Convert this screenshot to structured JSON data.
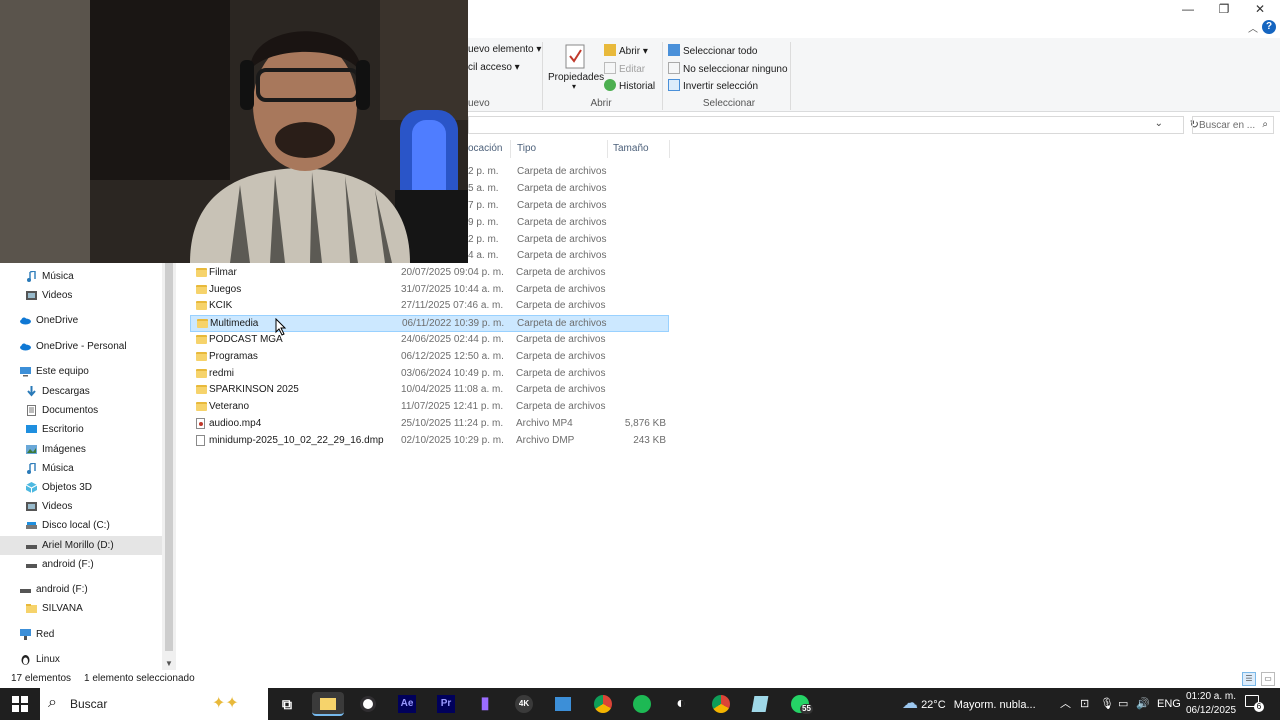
{
  "window": {
    "minimize": "—",
    "maximize": "❐",
    "close": "✕",
    "help": "?",
    "collapse": "︿"
  },
  "ribbon": {
    "new_item": "uevo elemento",
    "easy_access": "cil acceso",
    "new_group": "uevo",
    "properties": "Propiedades",
    "open": "Abrir",
    "edit": "Editar",
    "history": "Historial",
    "open_group": "Abrir",
    "select_all": "Seleccionar todo",
    "select_none": "No seleccionar ninguno",
    "invert_selection": "Invertir selección",
    "select_group": "Seleccionar"
  },
  "address": {
    "search_placeholder": "Buscar en ..."
  },
  "columns": {
    "location": "ocación",
    "type": "Tipo",
    "size": "Tamaño"
  },
  "partial_rows": [
    {
      "date": "2 p. m.",
      "type": "Carpeta de archivos"
    },
    {
      "date": "5 a. m.",
      "type": "Carpeta de archivos"
    },
    {
      "date": "7 p. m.",
      "type": "Carpeta de archivos"
    },
    {
      "date": "9 p. m.",
      "type": "Carpeta de archivos"
    },
    {
      "date": "2 p. m.",
      "type": "Carpeta de archivos"
    },
    {
      "date": "4 a. m.",
      "type": "Carpeta de archivos"
    }
  ],
  "files": [
    {
      "name": "Filmar",
      "date": "20/07/2025 09:04 p. m.",
      "type": "Carpeta de archivos",
      "size": "",
      "kind": "folder"
    },
    {
      "name": "Juegos",
      "date": "31/07/2025 10:44 a. m.",
      "type": "Carpeta de archivos",
      "size": "",
      "kind": "folder"
    },
    {
      "name": "KCIK",
      "date": "27/11/2025 07:46 a. m.",
      "type": "Carpeta de archivos",
      "size": "",
      "kind": "folder"
    },
    {
      "name": "Multimedia",
      "date": "06/11/2022 10:39 p. m.",
      "type": "Carpeta de archivos",
      "size": "",
      "kind": "folder"
    },
    {
      "name": "PODCAST MGA",
      "date": "24/06/2025 02:44 p. m.",
      "type": "Carpeta de archivos",
      "size": "",
      "kind": "folder"
    },
    {
      "name": "Programas",
      "date": "06/12/2025 12:50 a. m.",
      "type": "Carpeta de archivos",
      "size": "",
      "kind": "folder"
    },
    {
      "name": "redmi",
      "date": "03/06/2024 10:49 p. m.",
      "type": "Carpeta de archivos",
      "size": "",
      "kind": "folder"
    },
    {
      "name": "SPARKINSON 2025",
      "date": "10/04/2025 11:08 a. m.",
      "type": "Carpeta de archivos",
      "size": "",
      "kind": "folder"
    },
    {
      "name": "Veterano",
      "date": "11/07/2025 12:41 p. m.",
      "type": "Carpeta de archivos",
      "size": "",
      "kind": "folder"
    },
    {
      "name": "audioo.mp4",
      "date": "25/10/2025 11:24 p. m.",
      "type": "Archivo MP4",
      "size": "5,876 KB",
      "kind": "mp4"
    },
    {
      "name": "minidump-2025_10_02_22_29_16.dmp",
      "date": "02/10/2025 10:29 p. m.",
      "type": "Archivo DMP",
      "size": "243 KB",
      "kind": "file"
    }
  ],
  "nav": [
    {
      "label": "Música",
      "icon": "music-icon"
    },
    {
      "label": "Videos",
      "icon": "video-icon"
    },
    {
      "label": "OneDrive",
      "icon": "cloud-icon"
    },
    {
      "label": "OneDrive - Personal",
      "icon": "cloud-icon"
    },
    {
      "label": "Este equipo",
      "icon": "computer-icon"
    },
    {
      "label": "Descargas",
      "icon": "download-icon"
    },
    {
      "label": "Documentos",
      "icon": "document-icon"
    },
    {
      "label": "Escritorio",
      "icon": "desktop-icon"
    },
    {
      "label": "Imágenes",
      "icon": "image-icon"
    },
    {
      "label": "Música",
      "icon": "music-icon"
    },
    {
      "label": "Objetos 3D",
      "icon": "cube-icon"
    },
    {
      "label": "Videos",
      "icon": "video-icon"
    },
    {
      "label": "Disco local (C:)",
      "icon": "drive-icon"
    },
    {
      "label": "Ariel Morillo (D:)",
      "icon": "drive-icon"
    },
    {
      "label": "android (F:)",
      "icon": "drive-icon"
    },
    {
      "label": "android (F:)",
      "icon": "drive-icon"
    },
    {
      "label": "SILVANA",
      "icon": "folder-icon"
    },
    {
      "label": "Red",
      "icon": "network-icon"
    },
    {
      "label": "Linux",
      "icon": "linux-icon"
    }
  ],
  "status": {
    "count": "17 elementos",
    "selected": "1 elemento seleccionado"
  },
  "taskbar": {
    "search": "Buscar",
    "weather_temp": "22°C",
    "weather_text": "Mayorm. nubla...",
    "language": "ENG",
    "time": "01:20 a. m.",
    "date": "06/12/2025",
    "badge": "55",
    "notif": "6",
    "ae": "Ae",
    "pr": "Pr",
    "fourk": "4K"
  }
}
